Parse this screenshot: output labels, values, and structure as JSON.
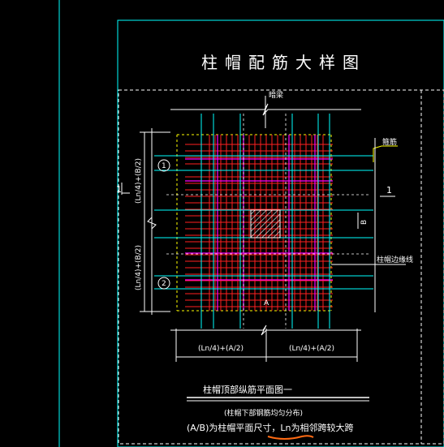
{
  "drawing": {
    "title": "柱帽配筋大样图",
    "label_column": "暗梁",
    "label_rebar": "箍筋",
    "label_cap_edge": "柱帽边缘线",
    "axis_1": "1",
    "axis_2": "2",
    "section_mark_left": "1",
    "section_mark_right": "1",
    "left_dim_top": "(Ln/4)+(B/2)",
    "left_dim_bottom": "(Ln/4)+(B/2)",
    "bottom_dim_left": "(Ln/4)+(A/2)",
    "bottom_dim_right": "(Ln/4)+(A/2)",
    "mark_a": "A",
    "mark_b": "B",
    "caption_title": "柱帽顶部纵筋平面图一",
    "caption_note1": "(柱帽下部钢筋均匀分布)",
    "caption_note2_prefix": "(A/B)为柱帽平面尺寸，Ln",
    "caption_note2_suffix": "为相邻跨较大跨",
    "colors": {
      "background": "#000000",
      "frame": "#00ffff",
      "rebar_red": "#ff2020",
      "rebar_magenta": "#ff00ff",
      "dashed_yellow": "#ffff00",
      "text": "#ffffff",
      "underline": "#ff6a13"
    }
  }
}
